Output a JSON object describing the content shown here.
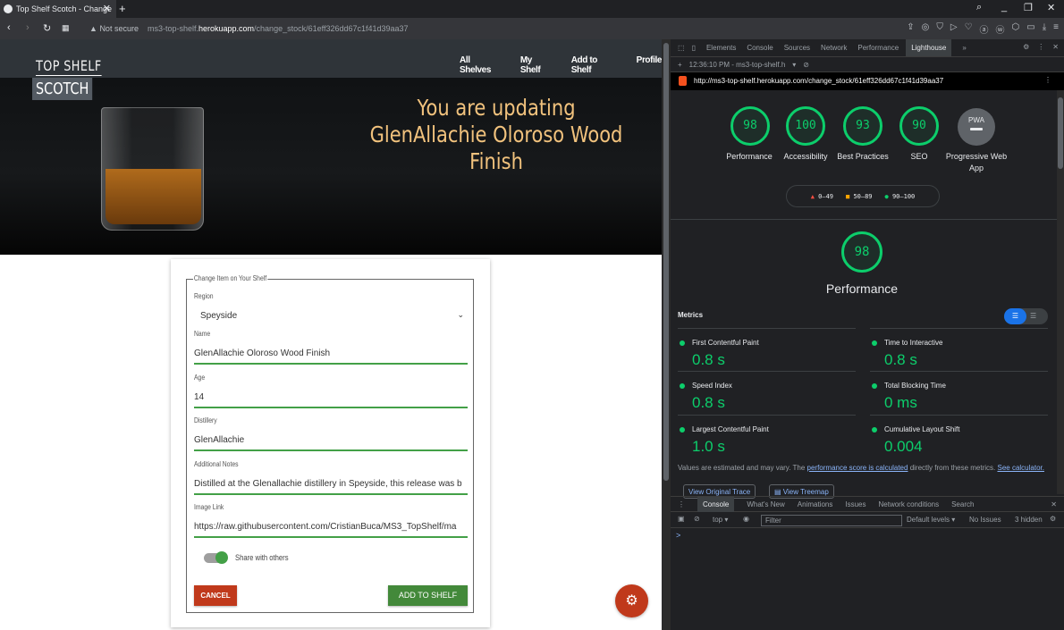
{
  "browser": {
    "tab_title": "Top Shelf Scotch - Change",
    "not_secure": "Not secure",
    "url_prefix": "ms3-top-shelf.",
    "url_host": "herokuapp.com",
    "url_path": "/change_stock/61eff326dd67c1f41d39aa37"
  },
  "site": {
    "logo_line1": "TOP SHELF",
    "logo_line2": "SCOTCH",
    "nav": [
      "All Shelves",
      "My Shelf",
      "Add to Shelf",
      "Profile"
    ],
    "hero_title": "You are updating GlenAllachie Oloroso Wood Finish"
  },
  "form": {
    "legend": "Change Item on Your Shelf",
    "region_label": "Region",
    "region_value": "Speyside",
    "name_label": "Name",
    "name_value": "GlenAllachie Oloroso Wood Finish",
    "age_label": "Age",
    "age_value": "14",
    "distillery_label": "Distillery",
    "distillery_value": "GlenAllachie",
    "notes_label": "Additional Notes",
    "notes_value": "Distilled at the Glenallachie distillery in Speyside, this release was b",
    "image_label": "Image Link",
    "image_value": "https://raw.githubusercontent.com/CristianBuca/MS3_TopShelf/ma",
    "share_label": "Share with others",
    "share_enabled": true,
    "cancel": "CANCEL",
    "submit": "ADD TO SHELF"
  },
  "devtools": {
    "tabs": [
      "Elements",
      "Console",
      "Sources",
      "Network",
      "Performance",
      "Lighthouse"
    ],
    "active_tab": "Lighthouse",
    "report_time": "12:36:10 PM - ms3-top-shelf.h",
    "report_url": "http://ms3-top-shelf.herokuapp.com/change_stock/61eff326dd67c1f41d39aa37",
    "scores": [
      {
        "value": "98",
        "label": "Performance"
      },
      {
        "value": "100",
        "label": "Accessibility"
      },
      {
        "value": "93",
        "label": "Best Practices"
      },
      {
        "value": "90",
        "label": "SEO"
      }
    ],
    "pwa": {
      "badge": "PWA",
      "label": "Progressive Web App"
    },
    "legend": {
      "fail": "0–49",
      "average": "50–89",
      "pass": "90–100"
    },
    "performance_score": "98",
    "performance_title": "Performance",
    "metrics_title": "Metrics",
    "metrics": [
      {
        "name": "First Contentful Paint",
        "value": "0.8 s"
      },
      {
        "name": "Time to Interactive",
        "value": "0.8 s"
      },
      {
        "name": "Speed Index",
        "value": "0.8 s"
      },
      {
        "name": "Total Blocking Time",
        "value": "0 ms"
      },
      {
        "name": "Largest Contentful Paint",
        "value": "1.0 s"
      },
      {
        "name": "Cumulative Layout Shift",
        "value": "0.004"
      }
    ],
    "note_text": "Values are estimated and may vary. The ",
    "note_link1": "performance score is calculated",
    "note_mid": " directly from these metrics. ",
    "note_link2": "See calculator.",
    "view_trace": "View Original Trace",
    "view_treemap": "View Treemap",
    "drawer_tabs": [
      "Console",
      "What's New",
      "Animations",
      "Issues",
      "Network conditions",
      "Search"
    ],
    "console": {
      "context": "top ▾",
      "filter_placeholder": "Filter",
      "levels": "Default levels ▾",
      "issues": "No Issues",
      "hidden": "3 hidden",
      "prompt": ">"
    }
  },
  "colors": {
    "pass": "#0cce6b",
    "accent_red": "#c0391b",
    "accent_green": "#43893a",
    "hero_text": "#f1c27d"
  }
}
